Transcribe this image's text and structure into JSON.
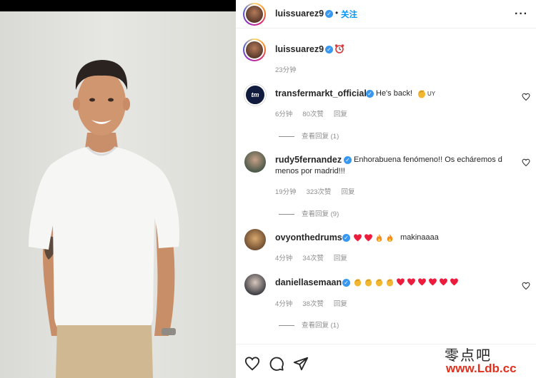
{
  "post": {
    "username": "luissuarez9",
    "follow_label": "关注",
    "more_icon": "more-horizontal-icon",
    "caption_emoji": "alarm-clock-emoji",
    "caption_time": "23分钟"
  },
  "comments": [
    {
      "username": "transfermarkt_official",
      "avatar_text": "tm",
      "text": "He's back!",
      "emoji_suffix": "UY",
      "time": "6分钟",
      "likes": "80次赞",
      "reply_label": "回复",
      "view_replies": "查看回复 (1)"
    },
    {
      "username": "rudy5fernandez",
      "text": "Enhorabuena fenómeno!! Os echáremos d menos por madrid!!!",
      "time": "19分钟",
      "likes": "323次赞",
      "reply_label": "回复",
      "view_replies": "查看回复 (9)"
    },
    {
      "username": "ovyonthedrums",
      "text": "makinaaaa",
      "time": "4分钟",
      "likes": "34次赞",
      "reply_label": "回复"
    },
    {
      "username": "daniellasemaan",
      "time": "4分钟",
      "likes": "38次赞",
      "reply_label": "回复",
      "view_replies": "查看回复 (1)"
    }
  ],
  "actions": {
    "like_icon": "heart-icon",
    "comment_icon": "comment-icon",
    "share_icon": "send-icon"
  },
  "watermark": {
    "chinese": "零点吧",
    "url": "www.Ldb.cc"
  },
  "colors": {
    "accent": "#0095f6",
    "verified": "#3897f0",
    "heart_red": "#ed1c3c",
    "meta_gray": "#8e8e8e"
  }
}
